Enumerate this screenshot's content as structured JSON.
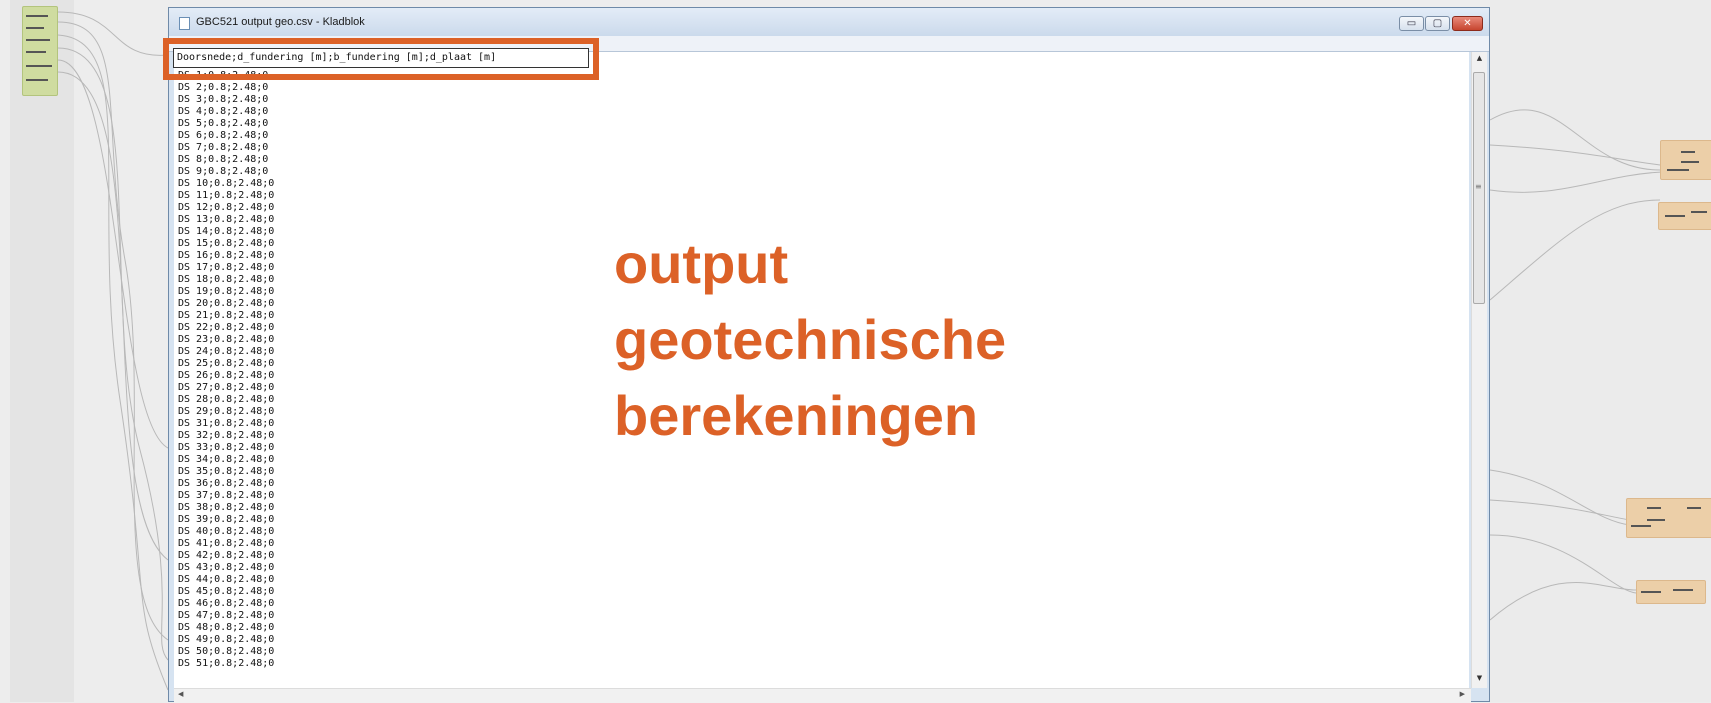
{
  "window": {
    "title": "GBC521 output geo.csv - Kladblok",
    "controls": {
      "minimize": "▭",
      "maximize": "▢",
      "close": "✕"
    }
  },
  "editor": {
    "header": "Doorsnede;d_fundering [m];b_fundering [m];d_plaat [m]",
    "lines": [
      "DS 1;0.8;2.48;0",
      "DS 2;0.8;2.48;0",
      "DS 3;0.8;2.48;0",
      "DS 4;0.8;2.48;0",
      "DS 5;0.8;2.48;0",
      "DS 6;0.8;2.48;0",
      "DS 7;0.8;2.48;0",
      "DS 8;0.8;2.48;0",
      "DS 9;0.8;2.48;0",
      "DS 10;0.8;2.48;0",
      "DS 11;0.8;2.48;0",
      "DS 12;0.8;2.48;0",
      "DS 13;0.8;2.48;0",
      "DS 14;0.8;2.48;0",
      "DS 15;0.8;2.48;0",
      "DS 16;0.8;2.48;0",
      "DS 17;0.8;2.48;0",
      "DS 18;0.8;2.48;0",
      "DS 19;0.8;2.48;0",
      "DS 20;0.8;2.48;0",
      "DS 21;0.8;2.48;0",
      "DS 22;0.8;2.48;0",
      "DS 23;0.8;2.48;0",
      "DS 24;0.8;2.48;0",
      "DS 25;0.8;2.48;0",
      "DS 26;0.8;2.48;0",
      "DS 27;0.8;2.48;0",
      "DS 28;0.8;2.48;0",
      "DS 29;0.8;2.48;0",
      "DS 31;0.8;2.48;0",
      "DS 32;0.8;2.48;0",
      "DS 33;0.8;2.48;0",
      "DS 34;0.8;2.48;0",
      "DS 35;0.8;2.48;0",
      "DS 36;0.8;2.48;0",
      "DS 37;0.8;2.48;0",
      "DS 38;0.8;2.48;0",
      "DS 39;0.8;2.48;0",
      "DS 40;0.8;2.48;0",
      "DS 41;0.8;2.48;0",
      "DS 42;0.8;2.48;0",
      "DS 43;0.8;2.48;0",
      "DS 44;0.8;2.48;0",
      "DS 45;0.8;2.48;0",
      "DS 46;0.8;2.48;0",
      "DS 47;0.8;2.48;0",
      "DS 48;0.8;2.48;0",
      "DS 49;0.8;2.48;0",
      "DS 50;0.8;2.48;0",
      "DS 51;0.8;2.48;0"
    ]
  },
  "overlay": {
    "lines": [
      "output",
      "geotechnische",
      "berekeningen"
    ],
    "color": "#dc6127"
  },
  "highlight_color": "#dc6127"
}
